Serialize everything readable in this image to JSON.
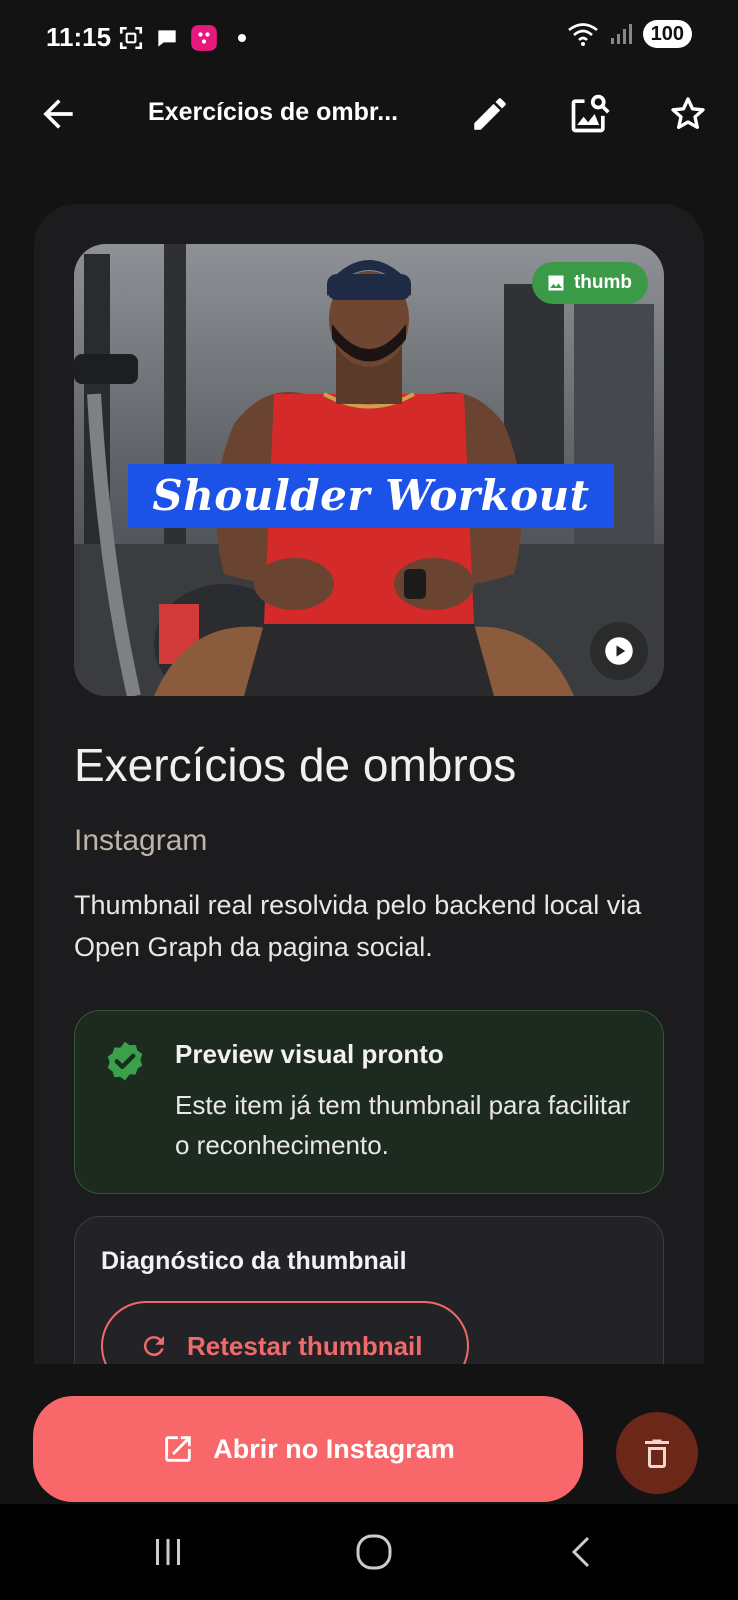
{
  "status": {
    "time": "11:15",
    "battery": "100"
  },
  "app_bar": {
    "title": "Exercícios de ombr...",
    "icons": [
      "back-arrow-icon",
      "pencil-icon",
      "image-search-icon",
      "star-icon"
    ]
  },
  "media": {
    "badge_label": "thumb",
    "overlay_text": "Shoulder Workout"
  },
  "item": {
    "title": "Exercícios de ombros",
    "source": "Instagram",
    "description": "Thumbnail real resolvida pelo backend local via Open Graph da pagina social."
  },
  "preview_status": {
    "title": "Preview visual pronto",
    "text": "Este item já tem thumbnail para facilitar o reconhecimento."
  },
  "diagnostics": {
    "title": "Diagnóstico da thumbnail",
    "retest_label": "Retestar thumbnail"
  },
  "actions": {
    "open_label": "Abrir no Instagram",
    "delete_icon": "trash-icon"
  },
  "colors": {
    "accent": "#f8686a",
    "success": "#3b9a48",
    "delete_bg": "#6b2717",
    "banner": "#1d52e8"
  }
}
